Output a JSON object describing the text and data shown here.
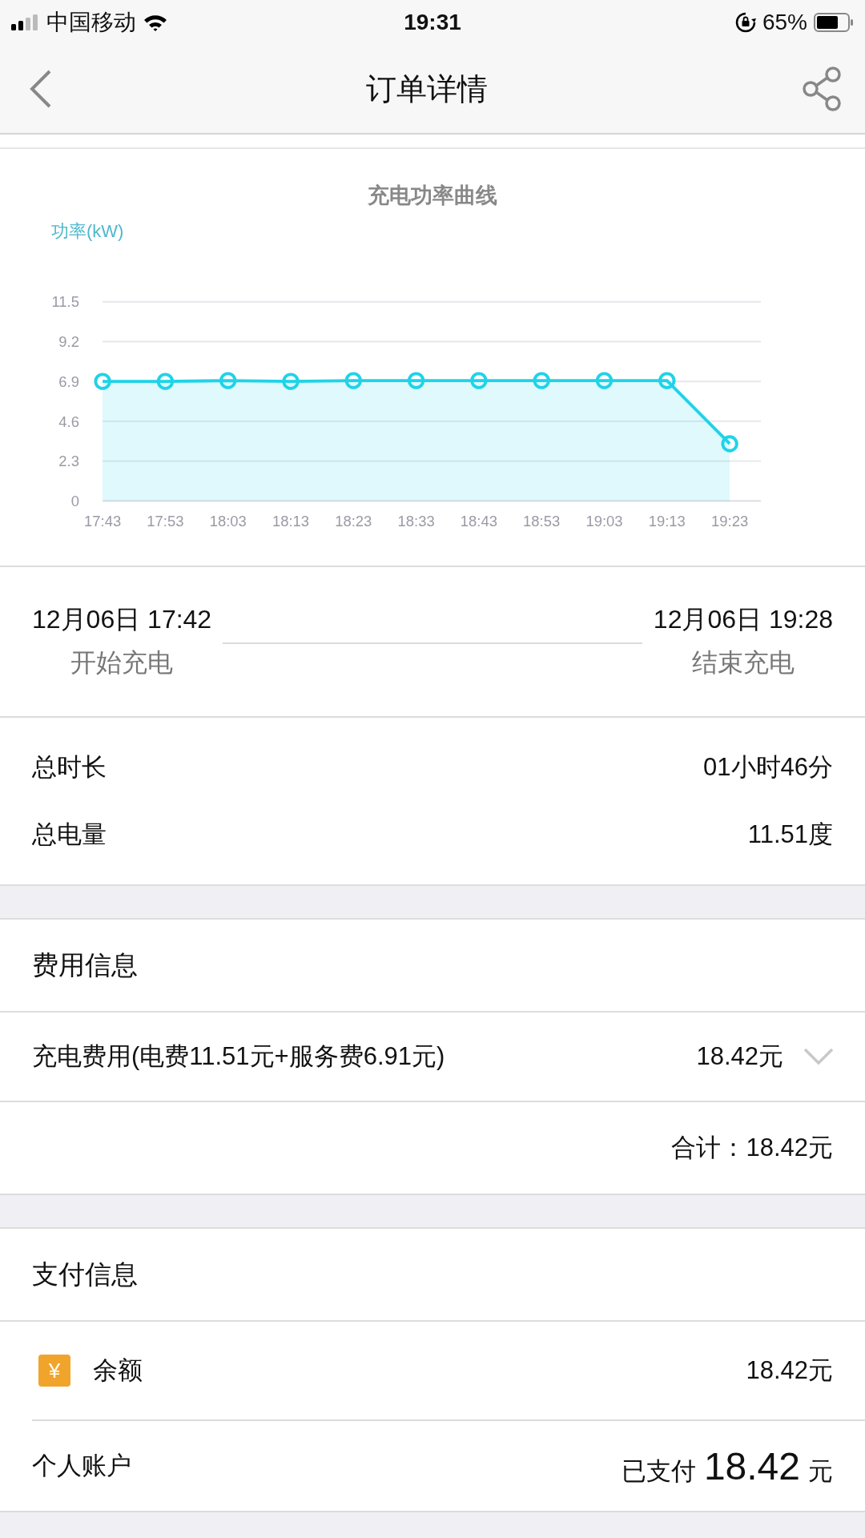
{
  "status_bar": {
    "carrier": "中国移动",
    "time": "19:31",
    "battery": "65%"
  },
  "nav": {
    "title": "订单详情"
  },
  "power_chart": {
    "chart_data": {
      "type": "area",
      "title": "充电功率曲线",
      "ylabel": "功率(kW)",
      "categories": [
        "17:43",
        "17:53",
        "18:03",
        "18:13",
        "18:23",
        "18:33",
        "18:43",
        "18:53",
        "19:03",
        "19:13",
        "19:23"
      ],
      "grid": true,
      "series": [
        {
          "color": "#1fd3e8",
          "values": [
            6.9,
            6.9,
            6.95,
            6.9,
            6.95,
            6.95,
            6.95,
            6.95,
            6.95,
            6.95,
            3.3
          ]
        }
      ],
      "ylim": [
        0,
        11.5
      ],
      "yticks": [
        0,
        2.3,
        4.6,
        6.9,
        9.2,
        11.5
      ]
    }
  },
  "session": {
    "start": {
      "time": "12月06日 17:42",
      "label": "开始充电"
    },
    "end": {
      "time": "12月06日 19:28",
      "label": "结束充电"
    }
  },
  "summary": [
    {
      "label": "总时长",
      "value": "01小时46分"
    },
    {
      "label": "总电量",
      "value": "11.51度"
    }
  ],
  "fees": {
    "heading": "费用信息",
    "items": [
      {
        "label": "充电费用(电费11.51元+服务费6.91元)",
        "value": "18.42元",
        "expanded": false
      }
    ],
    "total_label": "合计：",
    "total": "18.42元"
  },
  "payment": {
    "heading": "支付信息",
    "balance": {
      "label": "余额",
      "icon_text": "¥",
      "value": "18.42元"
    },
    "account": {
      "label": "个人账户",
      "paid_label": "已支付",
      "amount": "18.42",
      "unit": "元"
    }
  }
}
